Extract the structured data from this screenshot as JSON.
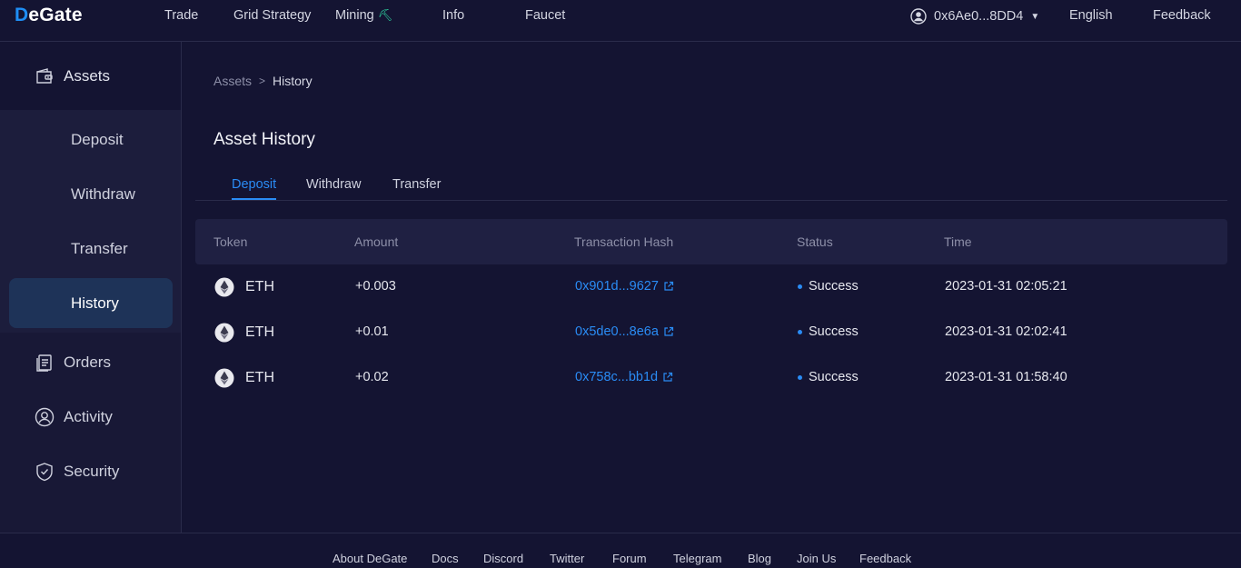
{
  "brand": {
    "logo_text": "DeGate"
  },
  "nav": {
    "items": [
      {
        "label": "Trade"
      },
      {
        "label": "Grid Strategy"
      },
      {
        "label": "Mining"
      },
      {
        "label": "Info"
      },
      {
        "label": "Faucet"
      }
    ],
    "account": "0x6Ae0...8DD4",
    "language": "English",
    "feedback": "Feedback"
  },
  "sidebar": {
    "assets": "Assets",
    "sub_items": [
      {
        "label": "Deposit"
      },
      {
        "label": "Withdraw"
      },
      {
        "label": "Transfer"
      },
      {
        "label": "History"
      }
    ],
    "orders": "Orders",
    "activity": "Activity",
    "security": "Security"
  },
  "breadcrumb": {
    "root": "Assets",
    "current": "History"
  },
  "page_title": "Asset History",
  "tabs": [
    {
      "label": "Deposit"
    },
    {
      "label": "Withdraw"
    },
    {
      "label": "Transfer"
    }
  ],
  "table": {
    "columns": [
      "Token",
      "Amount",
      "Transaction Hash",
      "Status",
      "Time"
    ],
    "rows": [
      {
        "token": "ETH",
        "amount": "+0.003",
        "hash": "0x901d...9627",
        "status": "Success",
        "time": "2023-01-31 02:05:21"
      },
      {
        "token": "ETH",
        "amount": "+0.01",
        "hash": "0x5de0...8e6a",
        "status": "Success",
        "time": "2023-01-31 02:02:41"
      },
      {
        "token": "ETH",
        "amount": "+0.02",
        "hash": "0x758c...bb1d",
        "status": "Success",
        "time": "2023-01-31 01:58:40"
      }
    ]
  },
  "footer": {
    "links": [
      {
        "label": "About DeGate"
      },
      {
        "label": "Docs"
      },
      {
        "label": "Discord"
      },
      {
        "label": "Twitter"
      },
      {
        "label": "Forum"
      },
      {
        "label": "Telegram"
      },
      {
        "label": "Blog"
      },
      {
        "label": "Join Us"
      },
      {
        "label": "Feedback"
      }
    ]
  },
  "colors": {
    "background": "#141432",
    "accent": "#2a8cf5",
    "mining_accent": "#2fd9a3",
    "active_sidebar": "#1e3358"
  }
}
